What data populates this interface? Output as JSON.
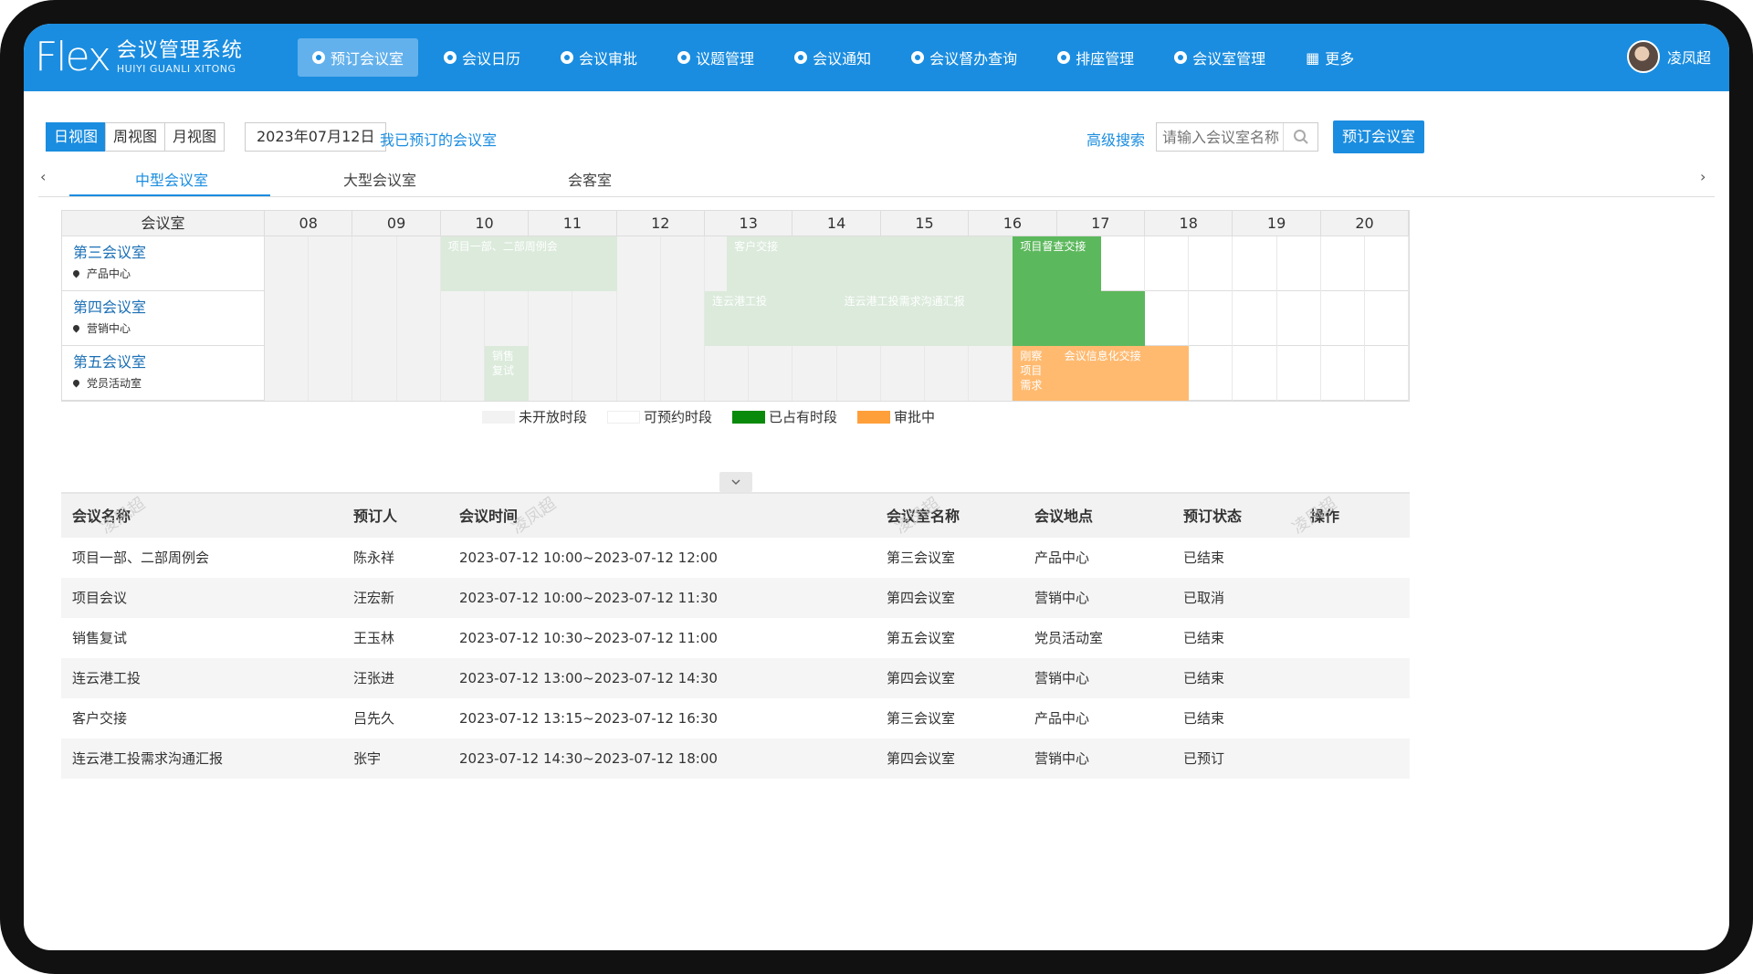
{
  "header": {
    "logo_mark": "Flex",
    "logo_cn": "会议管理系统",
    "logo_en": "HUIYI GUANLI XITONG",
    "nav": [
      {
        "label": "预订会议室",
        "active": true
      },
      {
        "label": "会议日历"
      },
      {
        "label": "会议审批"
      },
      {
        "label": "议题管理"
      },
      {
        "label": "会议通知"
      },
      {
        "label": "会议督办查询"
      },
      {
        "label": "排座管理"
      },
      {
        "label": "会议室管理"
      },
      {
        "label": "更多",
        "icon": "grid-icon"
      }
    ],
    "user_name": "凌凤超"
  },
  "toolbar": {
    "views": [
      "日视图",
      "周视图",
      "月视图"
    ],
    "active_view": "日视图",
    "date": "2023年07月12日",
    "my_bookings": "我已预订的会议室",
    "advanced_search": "高级搜索",
    "search_placeholder": "请输入会议室名称",
    "book_button": "预订会议室"
  },
  "room_tabs": [
    "中型会议室",
    "大型会议室",
    "会客室"
  ],
  "schedule": {
    "room_header": "会议室",
    "hours": [
      "08",
      "09",
      "10",
      "11",
      "12",
      "13",
      "14",
      "15",
      "16",
      "17",
      "18",
      "19",
      "20"
    ],
    "rooms": [
      {
        "name": "第三会议室",
        "location": "产品中心"
      },
      {
        "name": "第四会议室",
        "location": "营销中心"
      },
      {
        "name": "第五会议室",
        "location": "党员活动室"
      }
    ],
    "events": [
      {
        "room": 0,
        "title": "项目一部、二部周例会",
        "start": "10:00",
        "end": "12:00",
        "status": "past"
      },
      {
        "room": 0,
        "title": "客户交接",
        "start": "13:15",
        "end": "16:30",
        "status": "past"
      },
      {
        "room": 0,
        "title": "项目督查交接",
        "start": "16:30",
        "end": "17:30",
        "status": "occupied"
      },
      {
        "room": 1,
        "title": "连云港工投",
        "start": "13:00",
        "end": "14:30",
        "status": "past"
      },
      {
        "room": 1,
        "title": "连云港工投需求沟通汇报",
        "start": "14:30",
        "end": "16:30",
        "status": "past"
      },
      {
        "room": 1,
        "title": "",
        "start": "16:30",
        "end": "18:00",
        "status": "occupied"
      },
      {
        "room": 2,
        "title": "销售复试",
        "start": "10:30",
        "end": "11:00",
        "status": "past"
      },
      {
        "room": 2,
        "title": "刚察项目需求",
        "start": "16:30",
        "end": "17:00",
        "status": "pending"
      },
      {
        "room": 2,
        "title": "会议信息化交接",
        "start": "17:00",
        "end": "18:30",
        "status": "pending"
      }
    ]
  },
  "legend": [
    {
      "label": "未开放时段",
      "color": "#f2f2f2"
    },
    {
      "label": "可预约时段",
      "color": "#ffffff"
    },
    {
      "label": "已占有时段",
      "color": "#0a8a0a"
    },
    {
      "label": "审批中",
      "color": "#ff9f3a"
    }
  ],
  "table": {
    "columns": [
      "会议名称",
      "预订人",
      "会议时间",
      "会议室名称",
      "会议地点",
      "预订状态",
      "操作"
    ],
    "rows": [
      [
        "项目一部、二部周例会",
        "陈永祥",
        "2023-07-12 10:00~2023-07-12 12:00",
        "第三会议室",
        "产品中心",
        "已结束"
      ],
      [
        "项目会议",
        "汪宏新",
        "2023-07-12 10:00~2023-07-12 11:30",
        "第四会议室",
        "营销中心",
        "已取消"
      ],
      [
        "销售复试",
        "王玉林",
        "2023-07-12 10:30~2023-07-12 11:00",
        "第五会议室",
        "党员活动室",
        "已结束"
      ],
      [
        "连云港工投",
        "汪张进",
        "2023-07-12 13:00~2023-07-12 14:30",
        "第四会议室",
        "营销中心",
        "已结束"
      ],
      [
        "客户交接",
        "吕先久",
        "2023-07-12 13:15~2023-07-12 16:30",
        "第三会议室",
        "产品中心",
        "已结束"
      ],
      [
        "连云港工投需求沟通汇报",
        "张宇",
        "2023-07-12 14:30~2023-07-12 18:00",
        "第四会议室",
        "营销中心",
        "已预订"
      ]
    ]
  },
  "watermark": "凌凤超"
}
